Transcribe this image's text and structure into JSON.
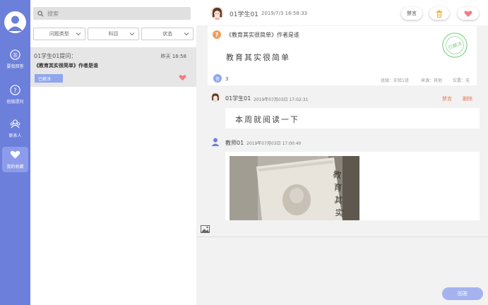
{
  "nav": {
    "items": [
      {
        "label": "要我回答"
      },
      {
        "label": "班级提问"
      },
      {
        "label": "联系人"
      },
      {
        "label": "我的收藏"
      }
    ]
  },
  "list": {
    "search_placeholder": "搜索",
    "filters": [
      {
        "label": "问题类型"
      },
      {
        "label": "科目"
      },
      {
        "label": "状态"
      }
    ],
    "item": {
      "author": "01学生01提问：",
      "time": "昨天 16:58",
      "title": "《教育其实很简单》作者是谁",
      "status": "已解决"
    }
  },
  "detail": {
    "header": {
      "name": "01学生01",
      "time": "2019/7/3 16:58:33",
      "mute_label": "禁言"
    },
    "question": {
      "icon_char": "?",
      "title": "《教育其实很简单》作者是谁",
      "body": "教育其实很简单",
      "stamp_text": "已解决",
      "reply_count_icon": "答",
      "reply_count": "3",
      "class_info": "班级：实验1班",
      "source": "来源：其他",
      "position": "位置：无"
    },
    "replies": [
      {
        "name": "01学生01",
        "time": "2019年07月03日 17:02:31",
        "text": "本周就阅读一下",
        "mute_label": "禁言",
        "delete_label": "删除"
      },
      {
        "name": "教师01",
        "time": "2019年07月03日 17:00:40"
      }
    ],
    "answer_label": "回答"
  },
  "colors": {
    "nav_bg": "#6b7fdb",
    "accent": "#8fa5ee",
    "heart": "#f07b82",
    "action": "#e07b57",
    "stamp": "#7ccf86"
  }
}
